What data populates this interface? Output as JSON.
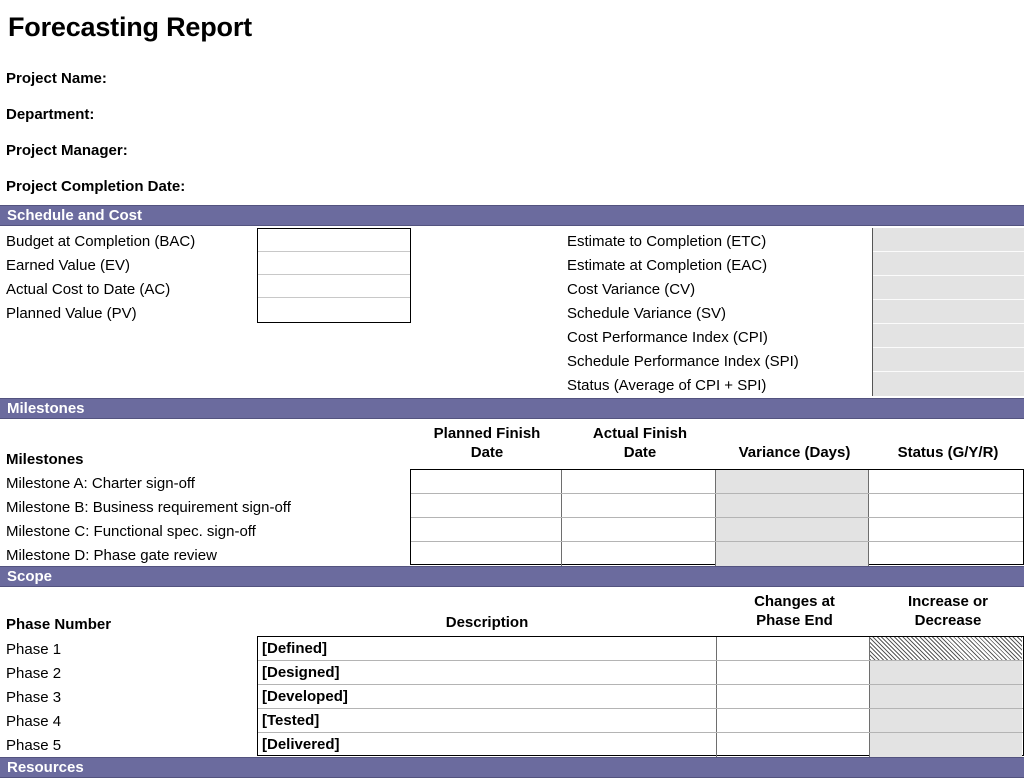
{
  "document": {
    "title": "Forecasting Report"
  },
  "header_fields": [
    {
      "label": "Project Name:"
    },
    {
      "label": "Department:"
    },
    {
      "label": "Project Manager:"
    },
    {
      "label": "Project Completion Date:"
    }
  ],
  "sections": {
    "schedule_and_cost": {
      "bar_label": "Schedule and Cost",
      "left_rows": [
        {
          "label": "Budget at Completion (BAC)",
          "value": ""
        },
        {
          "label": "Earned Value (EV)",
          "value": ""
        },
        {
          "label": "Actual Cost to Date (AC)",
          "value": ""
        },
        {
          "label": "Planned Value (PV)",
          "value": ""
        }
      ],
      "right_rows": [
        {
          "label": "Estimate to Completion (ETC)",
          "value": ""
        },
        {
          "label": "Estimate at Completion (EAC)",
          "value": ""
        },
        {
          "label": "Cost Variance (CV)",
          "value": ""
        },
        {
          "label": "Schedule Variance (SV)",
          "value": ""
        },
        {
          "label": "Cost Performance Index (CPI)",
          "value": ""
        },
        {
          "label": "Schedule Performance Index (SPI)",
          "value": ""
        },
        {
          "label": "Status (Average of CPI + SPI)",
          "value": ""
        }
      ]
    },
    "milestones": {
      "bar_label": "Milestones",
      "columns": [
        {
          "header_line1": "Milestones",
          "header_line2": ""
        },
        {
          "header_line1": "Planned Finish",
          "header_line2": "Date"
        },
        {
          "header_line1": "Actual Finish",
          "header_line2": "Date"
        },
        {
          "header_line1": "Variance (Days)",
          "header_line2": ""
        },
        {
          "header_line1": "Status (G/Y/R)",
          "header_line2": ""
        }
      ],
      "rows": [
        {
          "name": "Milestone A: Charter sign-off",
          "planned_finish_date": "",
          "actual_finish_date": "",
          "variance_days": "",
          "status": ""
        },
        {
          "name": "Milestone B: Business requirement sign-off",
          "planned_finish_date": "",
          "actual_finish_date": "",
          "variance_days": "",
          "status": ""
        },
        {
          "name": "Milestone C: Functional spec. sign-off",
          "planned_finish_date": "",
          "actual_finish_date": "",
          "variance_days": "",
          "status": ""
        },
        {
          "name": "Milestone D: Phase gate review",
          "planned_finish_date": "",
          "actual_finish_date": "",
          "variance_days": "",
          "status": ""
        }
      ]
    },
    "scope": {
      "bar_label": "Scope",
      "columns": [
        {
          "header_line1": "Phase Number",
          "header_line2": ""
        },
        {
          "header_line1": "Description",
          "header_line2": ""
        },
        {
          "header_line1": "Changes at",
          "header_line2": "Phase End"
        },
        {
          "header_line1": "Increase or",
          "header_line2": "Decrease"
        }
      ],
      "rows": [
        {
          "phase": "Phase 1",
          "description": "[Defined]",
          "changes_at_phase_end": "",
          "increase_or_decrease": ""
        },
        {
          "phase": "Phase 2",
          "description": "[Designed]",
          "changes_at_phase_end": "",
          "increase_or_decrease": ""
        },
        {
          "phase": "Phase 3",
          "description": "[Developed]",
          "changes_at_phase_end": "",
          "increase_or_decrease": ""
        },
        {
          "phase": "Phase 4",
          "description": "[Tested]",
          "changes_at_phase_end": "",
          "increase_or_decrease": ""
        },
        {
          "phase": "Phase 5",
          "description": "[Delivered]",
          "changes_at_phase_end": "",
          "increase_or_decrease": ""
        }
      ]
    },
    "resources": {
      "bar_label": "Resources"
    }
  },
  "colors": {
    "section_bar": "#6b6b9e",
    "section_bar_text": "#ffffff",
    "shaded_cell": "#e3e3e3",
    "page_background": "#ffffff",
    "text": "#000000"
  }
}
